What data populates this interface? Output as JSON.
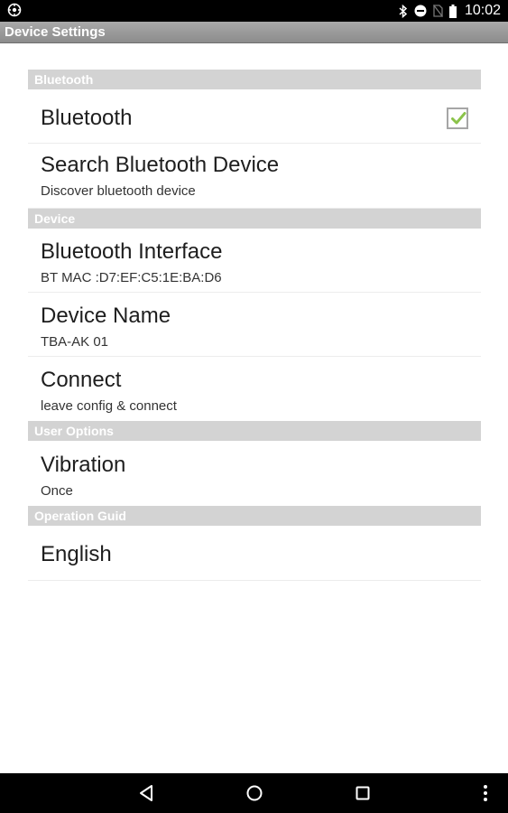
{
  "status_bar": {
    "time": "10:02",
    "icons": [
      "app-notification-icon",
      "bluetooth-icon",
      "do-not-disturb-icon",
      "no-sim-icon",
      "battery-icon"
    ]
  },
  "header": {
    "title": "Device Settings"
  },
  "sections": {
    "bluetooth": {
      "header": "Bluetooth",
      "bluetooth_pref": {
        "title": "Bluetooth",
        "checked": true
      },
      "search_pref": {
        "title": "Search Bluetooth Device",
        "summary": "Discover bluetooth device"
      }
    },
    "device": {
      "header": "Device",
      "interface_pref": {
        "title": "Bluetooth Interface",
        "summary": "BT MAC :D7:EF:C5:1E:BA:D6"
      },
      "name_pref": {
        "title": "Device Name",
        "summary": "TBA-AK 01"
      },
      "connect_pref": {
        "title": "Connect",
        "summary": "leave config & connect"
      }
    },
    "user_options": {
      "header": "User Options",
      "vibration_pref": {
        "title": "Vibration",
        "summary": "Once"
      }
    },
    "operation_guid": {
      "header": "Operation Guid",
      "language_pref": {
        "title": "English"
      }
    }
  },
  "colors": {
    "status_bar": "#000000",
    "title_bar": "#9a9a9a",
    "section_header": "#d3d3d3",
    "check_accent": "#8bc34a"
  },
  "nav_bar": {
    "icons": [
      "back-icon",
      "home-icon",
      "recents-icon",
      "overflow-menu-icon"
    ]
  }
}
